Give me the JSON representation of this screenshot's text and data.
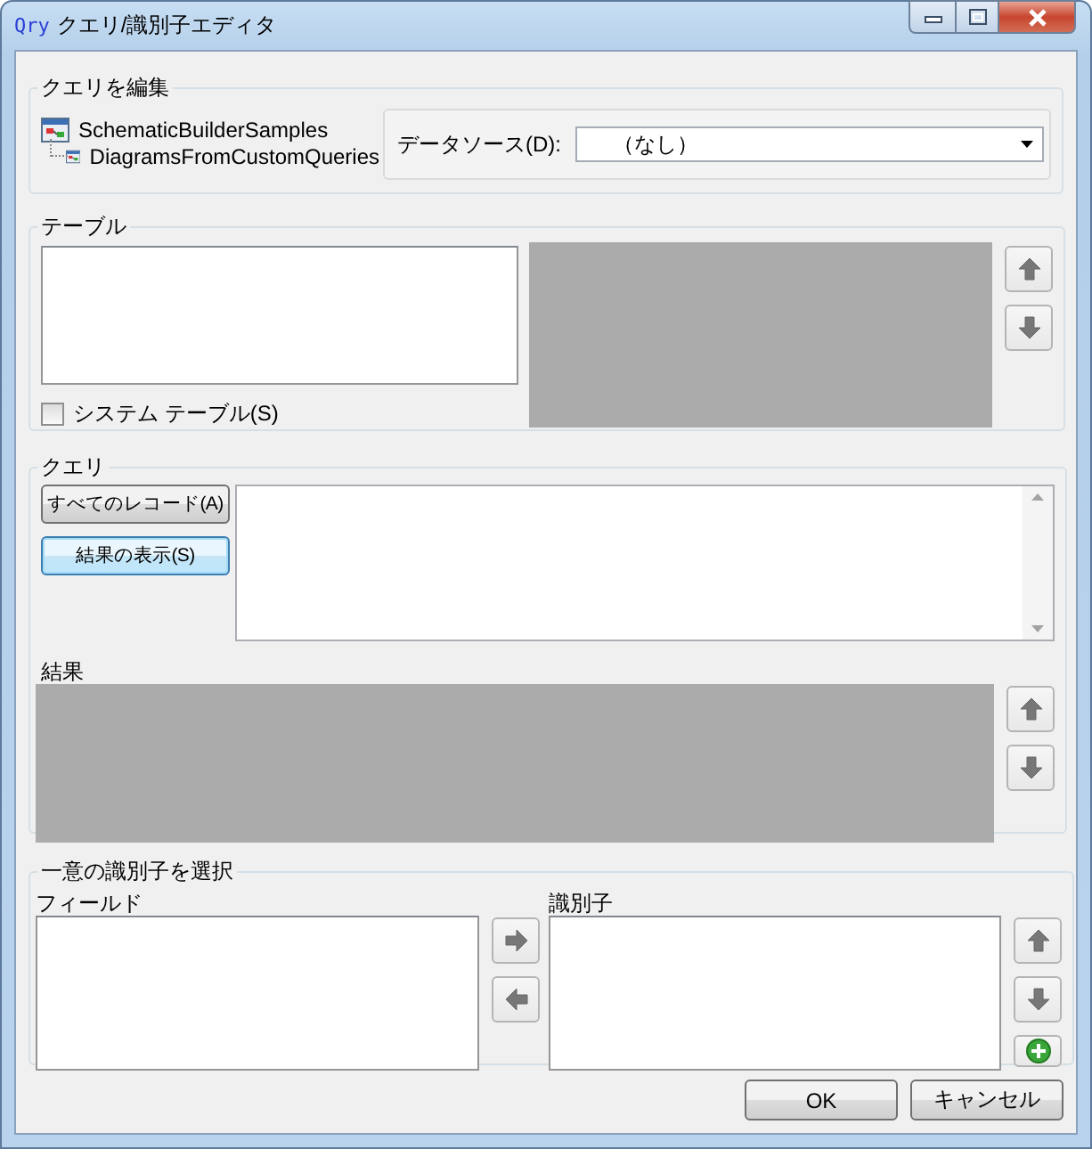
{
  "window": {
    "app_icon": "Qry",
    "title": "クエリ/識別子エディタ"
  },
  "edit_query": {
    "title": "クエリを編集",
    "tree": [
      {
        "label": "SchematicBuilderSamples",
        "children": [
          {
            "label": "DiagramsFromCustomQueries"
          }
        ]
      }
    ],
    "data_source": {
      "label": "データソース(D):",
      "value": "（なし）"
    }
  },
  "table": {
    "title": "テーブル",
    "system_tables": {
      "label": "システム テーブル(S)",
      "checked": false
    }
  },
  "query": {
    "title": "クエリ",
    "buttons": [
      {
        "label": "すべてのレコード(A)",
        "focused": false
      },
      {
        "label": "結果の表示(S)",
        "focused": true
      }
    ],
    "results_label": "結果"
  },
  "identifier": {
    "title": "一意の識別子を選択",
    "fields_label": "フィールド",
    "identifiers_label": "識別子"
  },
  "buttons": [
    "OK",
    "キャンセル"
  ]
}
